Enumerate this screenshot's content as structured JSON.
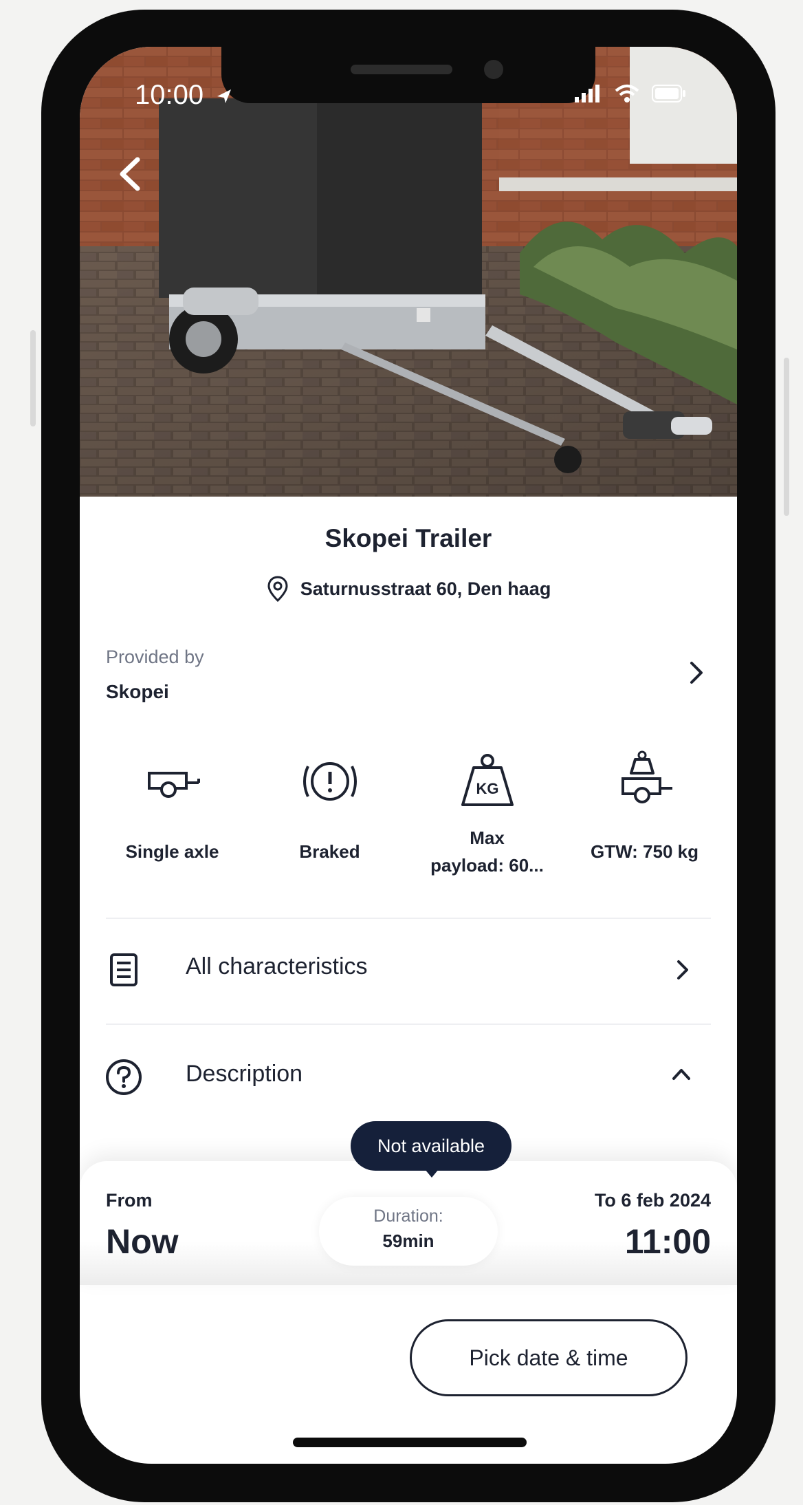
{
  "status_bar": {
    "time": "10:00"
  },
  "listing": {
    "title": "Skopei Trailer",
    "address": "Saturnusstraat 60, Den haag"
  },
  "provider": {
    "label": "Provided by",
    "name": "Skopei"
  },
  "features": [
    {
      "icon": "single-axle-trailer-icon",
      "label": "Single axle"
    },
    {
      "icon": "braked-icon",
      "label": "Braked"
    },
    {
      "icon": "kg-weight-icon",
      "label_line1": "Max",
      "label_line2": "payload: 60..."
    },
    {
      "icon": "gross-weight-trailer-icon",
      "label": "GTW: 750 kg"
    }
  ],
  "rows": {
    "characteristics": "All characteristics",
    "description": "Description"
  },
  "booking": {
    "tooltip": "Not available",
    "from_label": "From",
    "from_value": "Now",
    "duration_label": "Duration:",
    "duration_value": "59min",
    "to_label": "To 6 feb 2024",
    "to_value": "11:00",
    "pick_button": "Pick date & time"
  },
  "colors": {
    "text_primary": "#1d2230",
    "text_secondary": "#6f7585",
    "tooltip_bg": "#15203a"
  }
}
